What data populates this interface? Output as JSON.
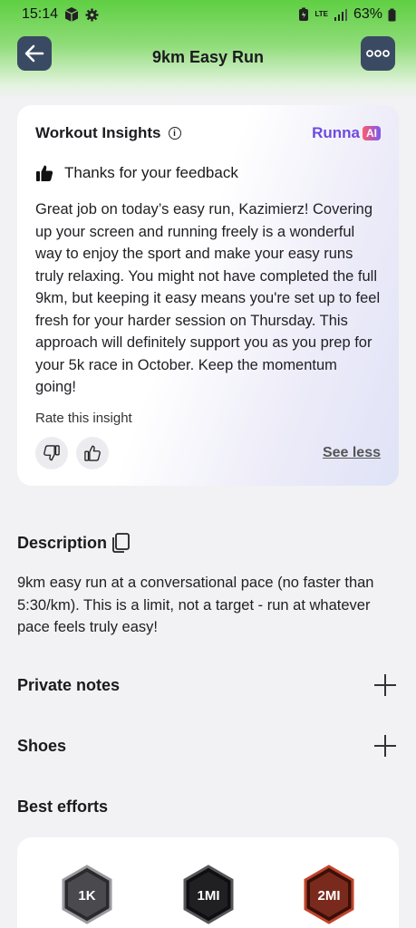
{
  "status_bar": {
    "time": "15:14",
    "network": "LTE",
    "battery": "63%"
  },
  "header": {
    "title": "9km Easy Run"
  },
  "insight": {
    "title": "Workout Insights",
    "brand_name": "Runna",
    "brand_badge": "AI",
    "feedback_text": "Thanks for your feedback",
    "body": "Great job on today’s easy run, Kazimierz! Covering up your screen and running freely is a wonderful way to enjoy the sport and make your easy runs truly relaxing. You might not have completed the full 9km, but keeping it easy means you're set up to feel fresh for your harder session on Thursday. This approach will definitely support you as you prep for your 5k race in October. Keep the momentum going!",
    "rate_label": "Rate this insight",
    "see_less": "See less"
  },
  "description": {
    "title": "Description",
    "text": "9km easy run at a conversational pace (no faster than 5:30/km). This is a limit, not a target - run at whatever pace feels truly easy!"
  },
  "sections": {
    "private_notes": "Private notes",
    "shoes": "Shoes",
    "best_efforts": "Best efforts"
  },
  "best_efforts": [
    {
      "label": "1K",
      "color": "#4a4a4e"
    },
    {
      "label": "1MI",
      "color": "#202022"
    },
    {
      "label": "2MI",
      "color": "#7a2a1c"
    }
  ],
  "colors": {
    "accent_green": "#5fcf43",
    "button_navy": "#3b4a63"
  }
}
